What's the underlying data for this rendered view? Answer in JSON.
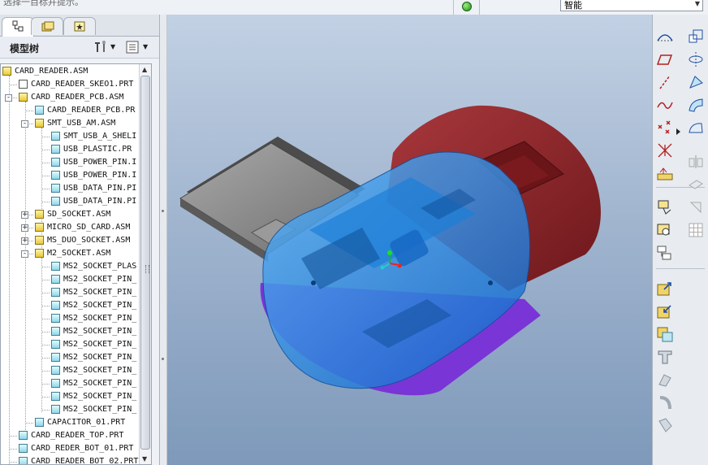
{
  "top_toolbar": {
    "hint_text": "选择一目标并提示。",
    "filter_value": "智能"
  },
  "model_tree": {
    "title": "模型树",
    "items": [
      {
        "label": "CARD_READER.ASM",
        "type": "asm"
      },
      {
        "label": "CARD_READER_SKEO1.PRT",
        "type": "skel"
      },
      {
        "label": "CARD_READER_PCB.ASM",
        "type": "asm"
      },
      {
        "label": "CARD_READER_PCB.PR",
        "type": "prt"
      },
      {
        "label": "SMT_USB_AM.ASM",
        "type": "asm"
      },
      {
        "label": "SMT_USB_A_SHELI",
        "type": "prt"
      },
      {
        "label": "USB_PLASTIC.PR",
        "type": "prt"
      },
      {
        "label": "USB_POWER_PIN.I",
        "type": "prt"
      },
      {
        "label": "USB_POWER_PIN.I",
        "type": "prt"
      },
      {
        "label": "USB_DATA_PIN.PI",
        "type": "prt"
      },
      {
        "label": "USB_DATA_PIN.PI",
        "type": "prt"
      },
      {
        "label": "SD_SOCKET.ASM",
        "type": "asm"
      },
      {
        "label": "MICRO_SD_CARD.ASM",
        "type": "asm"
      },
      {
        "label": "MS_DUO_SOCKET.ASM",
        "type": "asm"
      },
      {
        "label": "M2_SOCKET.ASM",
        "type": "asm"
      },
      {
        "label": "MS2_SOCKET_PLAS",
        "type": "prt"
      },
      {
        "label": "MS2_SOCKET_PIN_",
        "type": "prt"
      },
      {
        "label": "MS2_SOCKET_PIN_",
        "type": "prt"
      },
      {
        "label": "MS2_SOCKET_PIN_",
        "type": "prt"
      },
      {
        "label": "MS2_SOCKET_PIN_",
        "type": "prt"
      },
      {
        "label": "MS2_SOCKET_PIN_",
        "type": "prt"
      },
      {
        "label": "MS2_SOCKET_PIN_",
        "type": "prt"
      },
      {
        "label": "MS2_SOCKET_PIN_",
        "type": "prt"
      },
      {
        "label": "MS2_SOCKET_PIN_",
        "type": "prt"
      },
      {
        "label": "MS2_SOCKET_PIN_",
        "type": "prt"
      },
      {
        "label": "MS2_SOCKET_PIN_",
        "type": "prt"
      },
      {
        "label": "MS2_SOCKET_PIN_",
        "type": "prt"
      },
      {
        "label": "CAPACITOR_01.PRT",
        "type": "prt"
      },
      {
        "label": "CARD_READER_TOP.PRT",
        "type": "prt"
      },
      {
        "label": "CARD_REDER_BOT_01.PRT",
        "type": "prt"
      },
      {
        "label": "CARD_READER_BOT_02.PRT",
        "type": "prt"
      }
    ]
  },
  "colors": {
    "shell_blue": "#1f8de0",
    "cap_red": "#8e1f22",
    "base_purple": "#7a35d6",
    "card_gray": "#8f8f8f"
  }
}
